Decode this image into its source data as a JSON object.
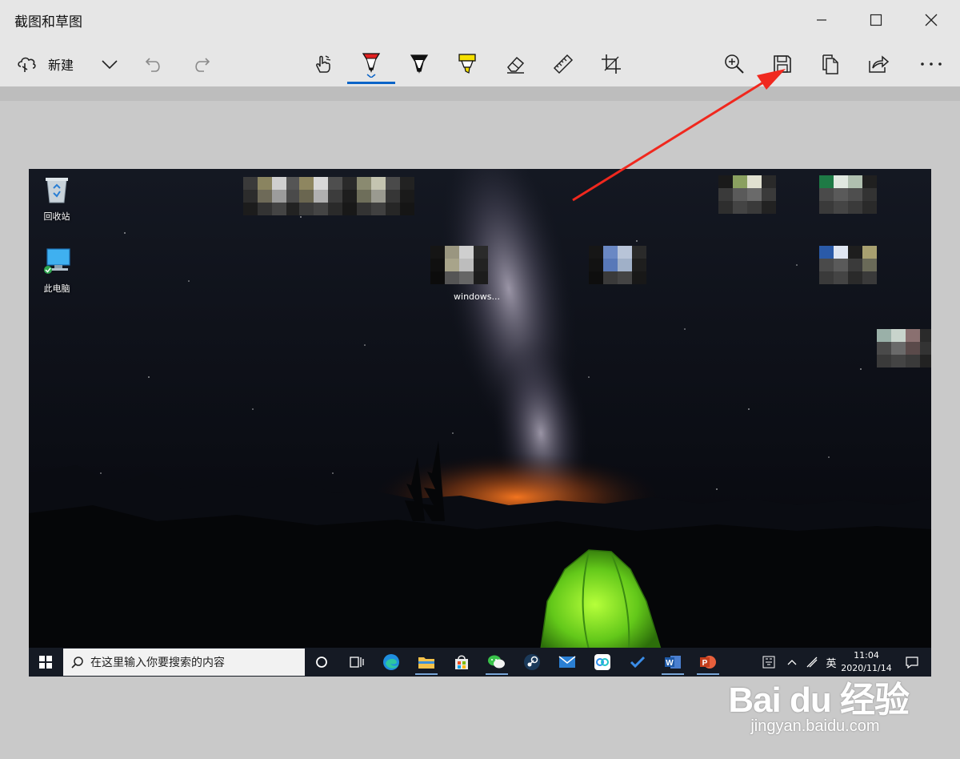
{
  "window": {
    "title": "截图和草图",
    "controls": [
      "minimize-icon",
      "maximize-icon",
      "close-icon"
    ]
  },
  "toolbar": {
    "new_label": "新建",
    "left_icons": [
      "new-snip-icon",
      "chevron-down-icon",
      "undo-icon",
      "redo-icon"
    ],
    "center_tools": [
      "touch-writing-icon",
      "ballpoint-pen-icon",
      "pencil-icon",
      "highlighter-icon",
      "eraser-icon",
      "ruler-icon",
      "crop-icon"
    ],
    "selected_tool": "ballpoint-pen",
    "right_icons": [
      "zoom-in-icon",
      "save-icon",
      "copy-icon",
      "share-icon",
      "more-icon"
    ]
  },
  "colors": {
    "toolbar_bg": "#e6e6e6",
    "canvas_bg": "#c9c9c9",
    "accent": "#0a64c8",
    "annotation_arrow": "#f0281e",
    "pen_red": "#e02020",
    "highlighter_yellow": "#f5e000"
  },
  "desktop": {
    "icons": [
      {
        "label": "回收站",
        "icon": "recycle-bin-icon"
      },
      {
        "label": "此电脑",
        "icon": "this-pc-icon"
      }
    ],
    "windows_label": "windows..."
  },
  "taskbar": {
    "search_placeholder": "在这里输入你要搜索的内容",
    "apps": [
      "cortana-icon",
      "task-view-icon",
      "edge-icon",
      "file-explorer-icon",
      "store-icon",
      "wechat-icon",
      "steam-icon",
      "mail-icon",
      "baidu-netdisk-icon",
      "todo-icon",
      "word-icon",
      "powerpoint-icon"
    ],
    "tray": {
      "ime": "英",
      "time": "11:04",
      "date": "2020/11/14"
    }
  },
  "watermark": {
    "logo": "Bai du 经验",
    "url": "jingyan.baidu.com"
  }
}
